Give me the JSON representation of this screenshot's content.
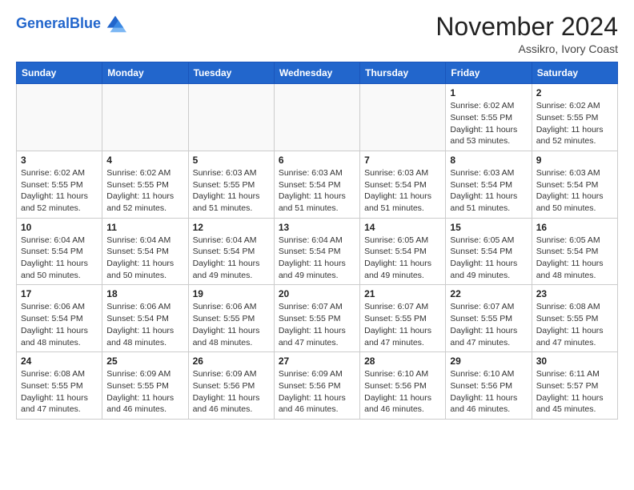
{
  "header": {
    "logo_general": "General",
    "logo_blue": "Blue",
    "month_title": "November 2024",
    "location": "Assikro, Ivory Coast"
  },
  "weekdays": [
    "Sunday",
    "Monday",
    "Tuesday",
    "Wednesday",
    "Thursday",
    "Friday",
    "Saturday"
  ],
  "weeks": [
    [
      {
        "day": "",
        "info": ""
      },
      {
        "day": "",
        "info": ""
      },
      {
        "day": "",
        "info": ""
      },
      {
        "day": "",
        "info": ""
      },
      {
        "day": "",
        "info": ""
      },
      {
        "day": "1",
        "info": "Sunrise: 6:02 AM\nSunset: 5:55 PM\nDaylight: 11 hours\nand 53 minutes."
      },
      {
        "day": "2",
        "info": "Sunrise: 6:02 AM\nSunset: 5:55 PM\nDaylight: 11 hours\nand 52 minutes."
      }
    ],
    [
      {
        "day": "3",
        "info": "Sunrise: 6:02 AM\nSunset: 5:55 PM\nDaylight: 11 hours\nand 52 minutes."
      },
      {
        "day": "4",
        "info": "Sunrise: 6:02 AM\nSunset: 5:55 PM\nDaylight: 11 hours\nand 52 minutes."
      },
      {
        "day": "5",
        "info": "Sunrise: 6:03 AM\nSunset: 5:55 PM\nDaylight: 11 hours\nand 51 minutes."
      },
      {
        "day": "6",
        "info": "Sunrise: 6:03 AM\nSunset: 5:54 PM\nDaylight: 11 hours\nand 51 minutes."
      },
      {
        "day": "7",
        "info": "Sunrise: 6:03 AM\nSunset: 5:54 PM\nDaylight: 11 hours\nand 51 minutes."
      },
      {
        "day": "8",
        "info": "Sunrise: 6:03 AM\nSunset: 5:54 PM\nDaylight: 11 hours\nand 51 minutes."
      },
      {
        "day": "9",
        "info": "Sunrise: 6:03 AM\nSunset: 5:54 PM\nDaylight: 11 hours\nand 50 minutes."
      }
    ],
    [
      {
        "day": "10",
        "info": "Sunrise: 6:04 AM\nSunset: 5:54 PM\nDaylight: 11 hours\nand 50 minutes."
      },
      {
        "day": "11",
        "info": "Sunrise: 6:04 AM\nSunset: 5:54 PM\nDaylight: 11 hours\nand 50 minutes."
      },
      {
        "day": "12",
        "info": "Sunrise: 6:04 AM\nSunset: 5:54 PM\nDaylight: 11 hours\nand 49 minutes."
      },
      {
        "day": "13",
        "info": "Sunrise: 6:04 AM\nSunset: 5:54 PM\nDaylight: 11 hours\nand 49 minutes."
      },
      {
        "day": "14",
        "info": "Sunrise: 6:05 AM\nSunset: 5:54 PM\nDaylight: 11 hours\nand 49 minutes."
      },
      {
        "day": "15",
        "info": "Sunrise: 6:05 AM\nSunset: 5:54 PM\nDaylight: 11 hours\nand 49 minutes."
      },
      {
        "day": "16",
        "info": "Sunrise: 6:05 AM\nSunset: 5:54 PM\nDaylight: 11 hours\nand 48 minutes."
      }
    ],
    [
      {
        "day": "17",
        "info": "Sunrise: 6:06 AM\nSunset: 5:54 PM\nDaylight: 11 hours\nand 48 minutes."
      },
      {
        "day": "18",
        "info": "Sunrise: 6:06 AM\nSunset: 5:54 PM\nDaylight: 11 hours\nand 48 minutes."
      },
      {
        "day": "19",
        "info": "Sunrise: 6:06 AM\nSunset: 5:55 PM\nDaylight: 11 hours\nand 48 minutes."
      },
      {
        "day": "20",
        "info": "Sunrise: 6:07 AM\nSunset: 5:55 PM\nDaylight: 11 hours\nand 47 minutes."
      },
      {
        "day": "21",
        "info": "Sunrise: 6:07 AM\nSunset: 5:55 PM\nDaylight: 11 hours\nand 47 minutes."
      },
      {
        "day": "22",
        "info": "Sunrise: 6:07 AM\nSunset: 5:55 PM\nDaylight: 11 hours\nand 47 minutes."
      },
      {
        "day": "23",
        "info": "Sunrise: 6:08 AM\nSunset: 5:55 PM\nDaylight: 11 hours\nand 47 minutes."
      }
    ],
    [
      {
        "day": "24",
        "info": "Sunrise: 6:08 AM\nSunset: 5:55 PM\nDaylight: 11 hours\nand 47 minutes."
      },
      {
        "day": "25",
        "info": "Sunrise: 6:09 AM\nSunset: 5:55 PM\nDaylight: 11 hours\nand 46 minutes."
      },
      {
        "day": "26",
        "info": "Sunrise: 6:09 AM\nSunset: 5:56 PM\nDaylight: 11 hours\nand 46 minutes."
      },
      {
        "day": "27",
        "info": "Sunrise: 6:09 AM\nSunset: 5:56 PM\nDaylight: 11 hours\nand 46 minutes."
      },
      {
        "day": "28",
        "info": "Sunrise: 6:10 AM\nSunset: 5:56 PM\nDaylight: 11 hours\nand 46 minutes."
      },
      {
        "day": "29",
        "info": "Sunrise: 6:10 AM\nSunset: 5:56 PM\nDaylight: 11 hours\nand 46 minutes."
      },
      {
        "day": "30",
        "info": "Sunrise: 6:11 AM\nSunset: 5:57 PM\nDaylight: 11 hours\nand 45 minutes."
      }
    ]
  ]
}
